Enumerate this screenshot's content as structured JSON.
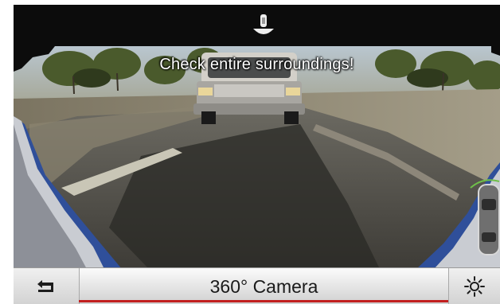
{
  "camera": {
    "warning_text": "Check entire surroundings!",
    "sensor_icon": "park-sensor-icon"
  },
  "toolbar": {
    "title": "360° Camera",
    "back_icon": "back-arrow-icon",
    "light_icon": "brightness-sun-icon",
    "accent_color": "#c21f1f"
  }
}
